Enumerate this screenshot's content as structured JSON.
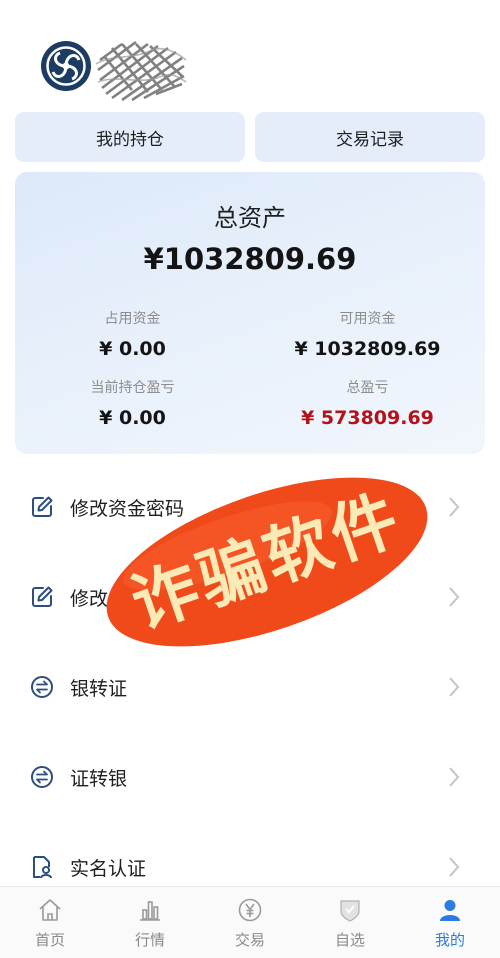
{
  "tabs": {
    "holdings": "我的持仓",
    "records": "交易记录"
  },
  "assets": {
    "title": "总资产",
    "total": "¥1032809.69",
    "occupied_label": "占用资金",
    "occupied_value": "¥ 0.00",
    "available_label": "可用资金",
    "available_value": "¥ 1032809.69",
    "position_pl_label": "当前持仓盈亏",
    "position_pl_value": "¥ 0.00",
    "total_pl_label": "总盈亏",
    "total_pl_value": "¥ 573809.69"
  },
  "menu": {
    "items": [
      {
        "label": "修改资金密码",
        "icon": "edit-icon"
      },
      {
        "label": "修改",
        "icon": "edit-icon"
      },
      {
        "label": "银转证",
        "icon": "transfer-icon"
      },
      {
        "label": "证转银",
        "icon": "transfer-icon"
      },
      {
        "label": "实名认证",
        "icon": "id-card-icon"
      }
    ]
  },
  "stamp": {
    "text": "诈骗软件",
    "color": "#f04a1a"
  },
  "bottom_nav": [
    {
      "label": "首页",
      "icon": "home-icon",
      "active": false
    },
    {
      "label": "行情",
      "icon": "chart-icon",
      "active": false
    },
    {
      "label": "交易",
      "icon": "yuan-icon",
      "active": false
    },
    {
      "label": "自选",
      "icon": "shield-icon",
      "active": false
    },
    {
      "label": "我的",
      "icon": "person-icon",
      "active": true
    }
  ],
  "colors": {
    "accent": "#2b7ce0",
    "loss_profit_red": "#b4121b",
    "card_bg": "#e4edf9",
    "logo": "#1d3c63"
  }
}
